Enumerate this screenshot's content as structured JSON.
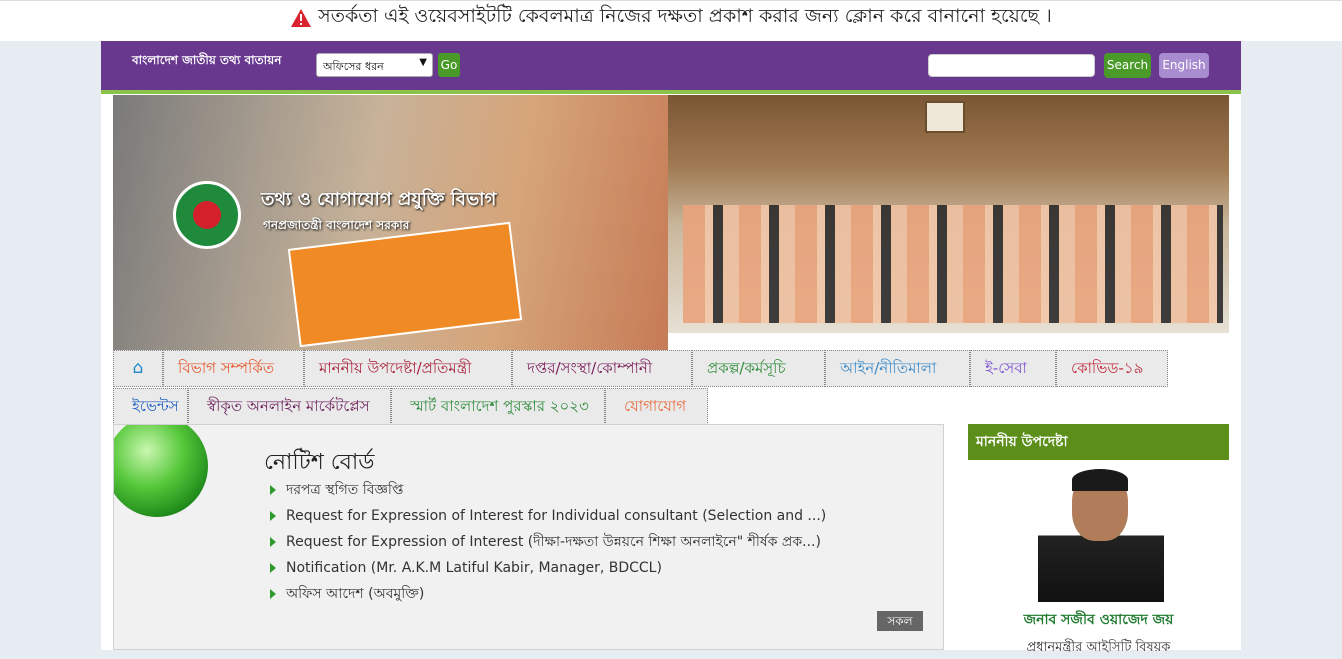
{
  "warning": {
    "icon": "warning-triangle-icon",
    "text": "সতর্কতা এই ওয়েবসাইটটি কেবলমাত্র নিজের দক্ষতা প্রকাশ করার জন্য ক্লোন করে বানানো হয়েছে ।"
  },
  "header": {
    "portal_title": "বাংলাদেশ জাতীয় তথ্য বাতায়ন",
    "office_type_select": "অফিসের ধরন",
    "go_label": "Go",
    "search_label": "Search",
    "language_label": "English",
    "colors": {
      "bar": "#68388f",
      "accent": "#8bc34a",
      "button_green": "#4a9a2a",
      "lang_button": "#a98bd0"
    }
  },
  "banner": {
    "ministry_name": "তথ্য ও যোগাযোগ প্রযুক্তি বিভাগ",
    "government_name": "গনপ্রজাতন্ত্রী বাংলাদেশ সরকার"
  },
  "nav": {
    "home_icon": "home-icon",
    "row1": [
      {
        "label": "বিভাগ সম্পর্কিত",
        "color": "#e6562a"
      },
      {
        "label": "মাননীয় উপদেষ্টা/প্রতিমন্ত্রী",
        "color": "#a8223a"
      },
      {
        "label": "দপ্তর/সংস্থা/কোম্পানী",
        "color": "#7a1f5c"
      },
      {
        "label": "প্রকল্প/কর্মসূচি",
        "color": "#2e8b3a"
      },
      {
        "label": "আইন/নীতিমালা",
        "color": "#3a8ac9"
      },
      {
        "label": "ই-সেবা",
        "color": "#7a4fd0"
      },
      {
        "label": "কোভিড-১৯",
        "color": "#c0283a"
      }
    ],
    "row2": [
      {
        "label": "ইভেন্টস",
        "color": "#1d5fbf"
      },
      {
        "label": "স্বীকৃত অনলাইন মার্কেটপ্লেস",
        "color": "#6a1f5a"
      },
      {
        "label": "স্মার্ট বাংলাদেশ পুরস্কার ২০২৩",
        "color": "#2e8b3a"
      },
      {
        "label": "যোগাযোগ",
        "color": "#e6663a"
      }
    ]
  },
  "notice_board": {
    "title": "নোটিশ বোর্ড",
    "items": [
      "দরপত্র স্থগিত বিজ্ঞপ্তি",
      "Request for Expression of Interest for Individual consultant (Selection and ...)",
      "Request for Expression of Interest (দীক্ষা-দক্ষতা উন্নয়নে শিক্ষা অনলাইনে\" শীর্ষক প্রক...)",
      "Notification (Mr. A.K.M Latiful Kabir, Manager, BDCCL)",
      "অফিস আদেশ (অবমুক্তি)"
    ],
    "all_label": "সকল"
  },
  "advisor": {
    "heading": "মাননীয় উপদেষ্টা",
    "name": "জনাব সজীব ওয়াজেদ জয়",
    "role": "প্রধানমন্ত্রীর আইসিটি বিষয়ক"
  }
}
